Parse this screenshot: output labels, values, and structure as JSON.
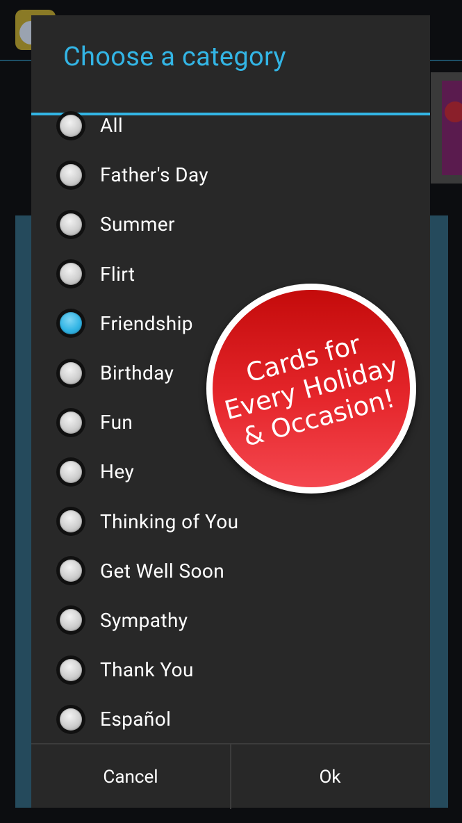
{
  "dialog": {
    "title": "Choose a category",
    "items": [
      {
        "label": "All",
        "checked": false
      },
      {
        "label": "Father's Day",
        "checked": false
      },
      {
        "label": "Summer",
        "checked": false
      },
      {
        "label": "Flirt",
        "checked": false
      },
      {
        "label": "Friendship",
        "checked": true
      },
      {
        "label": "Birthday",
        "checked": false
      },
      {
        "label": "Fun",
        "checked": false
      },
      {
        "label": "Hey",
        "checked": false
      },
      {
        "label": "Thinking of You",
        "checked": false
      },
      {
        "label": "Get Well Soon",
        "checked": false
      },
      {
        "label": "Sympathy",
        "checked": false
      },
      {
        "label": "Thank You",
        "checked": false
      },
      {
        "label": "Español",
        "checked": false
      }
    ],
    "cancel_label": "Cancel",
    "ok_label": "Ok"
  },
  "promo": {
    "line1": "Cards for",
    "line2": "Every Holiday",
    "line3": "& Occasion!"
  },
  "colors": {
    "accent": "#33b5e5",
    "badge_red": "#e5262b",
    "dialog_bg": "#282828"
  }
}
